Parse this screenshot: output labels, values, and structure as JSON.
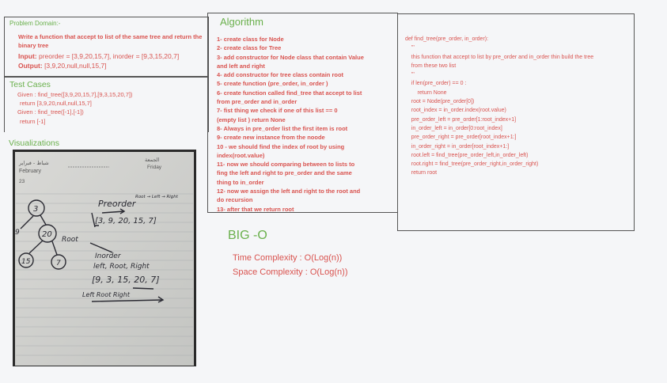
{
  "problem": {
    "title": "Problem Domain:-",
    "description": "Write a function that accept to list of the same tree and return the binary tree",
    "input_label": "Input:",
    "input_value": "preorder = [3,9,20,15,7], inorder = [9,3,15,20,7]",
    "output_label": "Output:",
    "output_value": "[3,9,20,null,null,15,7]"
  },
  "tests": {
    "title": "Test Cases",
    "lines": [
      "Given : find_tree([3,9,20,15,7],[9,3,15,20,7])",
      "return [3,9,20,null,null,15,7]",
      "Given : find_tree([-1],[-1])",
      "return [-1]"
    ]
  },
  "visualizations": {
    "title": "Visualizations",
    "calendar": {
      "month_ar": "شباط - فبراير",
      "month_en": "February",
      "day_ar": "الجمعة",
      "day_en": "Friday",
      "date": "23"
    },
    "sketch": {
      "preorder_label": "Preorder",
      "preorder_pattern": "Root → Left → Right",
      "preorder_array": "[3, 9, 20, 15, 7]",
      "inorder_label": "Inorder",
      "inorder_pattern": "left, Root, Right",
      "inorder_array": "[9, 3, 15, 20, 7]",
      "bottom_pattern": "Left  Root  Right",
      "root_label": "Root",
      "nodes": [
        "3",
        "9",
        "20",
        "15",
        "7"
      ]
    }
  },
  "algorithm": {
    "title": "Algorithm",
    "steps": [
      "1- create class for Node",
      "2- create class for Tree",
      "3- add constructor for Node class that contain Value",
      "and left and right",
      "4- add constructor for tree class contain root",
      "5- create function (pre_order, in_order )",
      "6- create function called find_tree that accept to list",
      "from pre_order and in_order",
      "7- fist thing we check if one of this list == 0",
      "(empty list ) return None",
      "8- Always in pre_order list the first item is root",
      "9- create new instance  from the noode",
      "10 -  we should find the index of root by using",
      "index(root.value)",
      "11- now we should comparing   between to lists to",
      "fing the left and right to pre_order and the same",
      "thing to in_order",
      "12- now we assign the left and right  to the root and",
      "do recursion",
      "13- after that we return root"
    ]
  },
  "code": {
    "lines": [
      "def find_tree(pre_order, in_order):",
      "    '''",
      "    this function that accept to list by pre_order and in_order thin build the tree",
      "    from these two list",
      "    '''",
      "    if len(pre_order) == 0 :",
      "        return None",
      "    root = Node(pre_order[0])",
      "    root_index = in_order.index(root.value)",
      "    pre_order_left = pre_order[1:root_index+1]",
      "    in_order_left = in_order[0:root_index]",
      "    pre_order_right = pre_order[root_index+1:]",
      "    in_order_right = in_order[root_index+1:]",
      "    root.left = find_tree(pre_order_left,in_order_left)",
      "    root.right = find_tree(pre_order_right,in_order_right)",
      "    return root"
    ]
  },
  "bigo": {
    "title": "BIG -O",
    "time": "Time Complexity : O(Log(n))",
    "space": "Space Complexity : O(Log(n))"
  },
  "colors": {
    "heading_green": "#6ab04c",
    "body_red": "#d9534f",
    "border": "#555555"
  }
}
